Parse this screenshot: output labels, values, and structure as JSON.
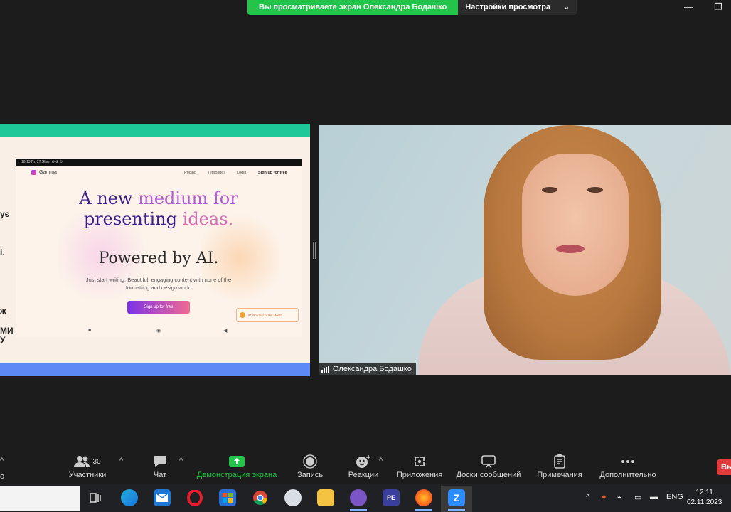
{
  "banner": {
    "viewing_text": "Вы просматриваете экран Олександра Бодашко",
    "view_settings_label": "Настройки просмотра",
    "view_settings_caret": "⌄"
  },
  "window_controls": {
    "minimize": "—",
    "restore": "❐"
  },
  "shared_screen": {
    "cut_off_text": [
      "ує",
      "і.",
      "ж",
      "МИ",
      "У"
    ],
    "slide": {
      "status_bar": "18:13 Пт, 27 Жовт ⊕ ⊗ ⊙",
      "logo": "Gamma",
      "nav": [
        "Pricing",
        "Templates",
        "Login",
        "Sign up for free"
      ],
      "headline_line1_a": "A new ",
      "headline_line1_b": "medium for",
      "headline_line2_a": "presenting ",
      "headline_line2_b": "ideas.",
      "powered": "Powered by AI.",
      "subtitle": "Just start writing. Beautiful, engaging content with none of the formatting and design work.",
      "signup_button": "Sign up for free",
      "product_hunt_small": "PRODUCT HUNT",
      "product_hunt": "#1 Product of the Month",
      "android_nav": [
        "■",
        "◉",
        "◀"
      ]
    }
  },
  "video": {
    "participant_name": "Олександра Бодашко"
  },
  "toolbar": {
    "participants_count": "30",
    "participants": "Участники",
    "chat": "Чат",
    "share_screen": "Демонстрация экрана",
    "record": "Запись",
    "reactions": "Реакции",
    "apps": "Приложения",
    "whiteboards": "Доски сообщений",
    "notes": "Примечания",
    "more": "Дополнительно",
    "end_button": "Вы",
    "left_cut": "о",
    "caret": "^"
  },
  "taskbar": {
    "language": "ENG",
    "time": "12:11",
    "date": "02.11.2023",
    "apps": [
      "task-view",
      "edge",
      "mail",
      "opera",
      "store",
      "chrome",
      "app-circle",
      "file-explorer",
      "viber",
      "document-app",
      "firefox",
      "zoom"
    ]
  },
  "colors": {
    "green": "#23c44a",
    "end_red": "#e03a3a",
    "dark_bg": "#1c1c1c"
  }
}
